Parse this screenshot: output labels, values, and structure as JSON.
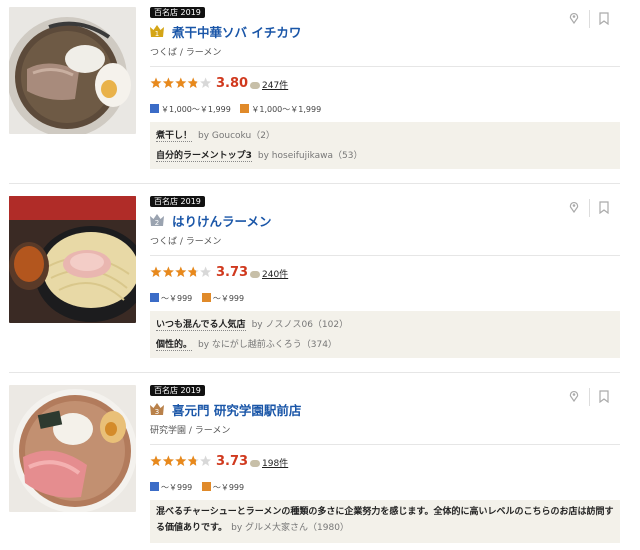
{
  "restaurants": [
    {
      "award": "百名店 2019",
      "rank": "1",
      "rank_color": "#d4a516",
      "name": "煮干中華ソバ イチカワ",
      "genre": "つくば / ラーメン",
      "rating": "3.80",
      "rating_value": 3.8,
      "review_count": "247件",
      "dinner_price": "￥1,000～￥1,999",
      "lunch_price": "￥1,000～￥1,999",
      "reviews": [
        {
          "title": "煮干し！",
          "by": "by Goucoku（2）"
        },
        {
          "title": "自分的ラーメントップ3",
          "by": "by hoseifujikawa（53）"
        }
      ]
    },
    {
      "award": "百名店 2019",
      "rank": "2",
      "rank_color": "#9aa3b0",
      "name": "はりけんラーメン",
      "genre": "つくば / ラーメン",
      "rating": "3.73",
      "rating_value": 3.73,
      "review_count": "240件",
      "dinner_price": "～￥999",
      "lunch_price": "～￥999",
      "reviews": [
        {
          "title": "いつも混んでる人気店",
          "by": "by ノスノス06（102）"
        },
        {
          "title": "個性的。",
          "by": "by なにがし越前ふくろう（374）"
        }
      ]
    },
    {
      "award": "百名店 2019",
      "rank": "3",
      "rank_color": "#b9814a",
      "name": "喜元門 研究学園駅前店",
      "genre": "研究学園 / ラーメン",
      "rating": "3.73",
      "rating_value": 3.73,
      "review_count": "198件",
      "dinner_price": "～￥999",
      "lunch_price": "～￥999",
      "reviews": [
        {
          "title": "混べるチャーシューとラーメンの種類の多さに企業努力を感じます。全体的に高いレベルのこちらのお店は訪問する価値ありです。",
          "by": "by グルメ大家さん（1980）"
        }
      ]
    }
  ],
  "colors": {
    "link": "#1a56a8",
    "score": "#d0391e",
    "star": "#e8891c",
    "review_bg": "#f3f1ea"
  }
}
